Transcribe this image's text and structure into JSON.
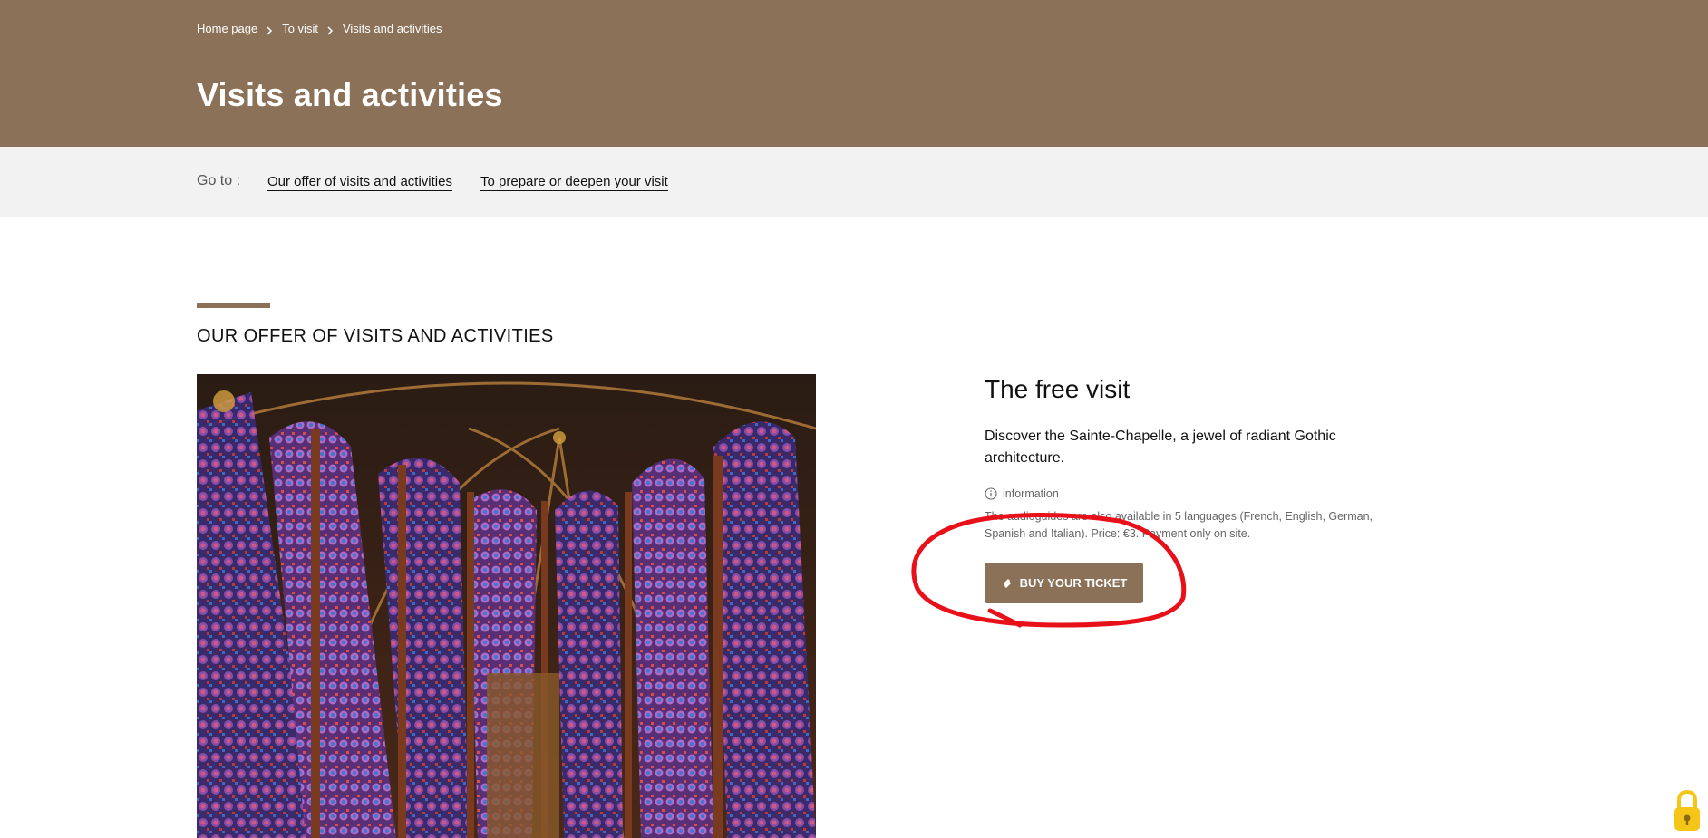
{
  "breadcrumb": {
    "items": [
      {
        "label": "Home page"
      },
      {
        "label": "To visit"
      },
      {
        "label": "Visits and activities"
      }
    ]
  },
  "page": {
    "title": "Visits and activities"
  },
  "goto": {
    "label": "Go to :",
    "links": [
      {
        "label": "Our offer of visits and activities"
      },
      {
        "label": "To prepare or deepen your visit"
      }
    ]
  },
  "section": {
    "title": "OUR OFFER OF VISITS AND ACTIVITIES"
  },
  "visit": {
    "title": "The free visit",
    "description": "Discover the Sainte-Chapelle, a jewel of radiant Gothic architecture.",
    "info_label": "information",
    "info_text": "The audioguides are also available in 5 languages (French, English, German, Spanish and Italian). Price: €3. Payment only on site.",
    "button_label": "BUY YOUR TICKET"
  },
  "icons": {
    "breadcrumb_separator": "chevron-right-icon",
    "info": "info-circle-icon",
    "ticket": "ticket-icon",
    "lock": "padlock-icon"
  },
  "colors": {
    "brand": "#8b7158",
    "goto_bar": "#f2f2f2",
    "annotation": "#e8111a",
    "lock_widget": "#f5c518"
  }
}
